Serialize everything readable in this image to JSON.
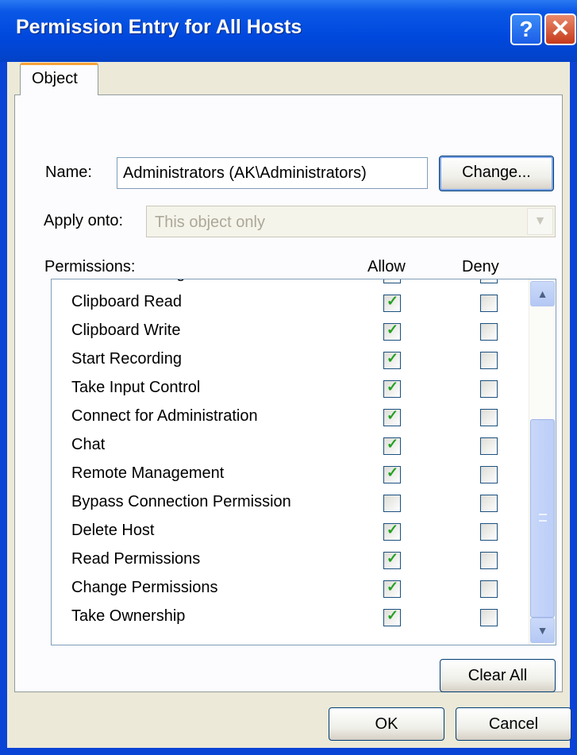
{
  "window": {
    "title": "Permission Entry for All Hosts",
    "help_glyph": "?",
    "close_glyph": "✕"
  },
  "tabs": [
    {
      "label": "Object"
    }
  ],
  "name_field": {
    "label": "Name:",
    "value": "Administrators (AK\\Administrators)"
  },
  "change_button": "Change...",
  "apply_onto": {
    "label": "Apply onto:",
    "value": "This object only"
  },
  "permissions": {
    "header_label": "Permissions:",
    "allow_label": "Allow",
    "deny_label": "Deny",
    "rows": [
      {
        "name": "Remote Printing",
        "allow": true,
        "deny": false
      },
      {
        "name": "Clipboard Read",
        "allow": true,
        "deny": false
      },
      {
        "name": "Clipboard Write",
        "allow": true,
        "deny": false
      },
      {
        "name": "Start Recording",
        "allow": true,
        "deny": false
      },
      {
        "name": "Take Input Control",
        "allow": true,
        "deny": false
      },
      {
        "name": "Connect for Administration",
        "allow": true,
        "deny": false
      },
      {
        "name": "Chat",
        "allow": true,
        "deny": false
      },
      {
        "name": "Remote Management",
        "allow": true,
        "deny": false
      },
      {
        "name": "Bypass Connection Permission",
        "allow": false,
        "deny": false
      },
      {
        "name": "Delete Host",
        "allow": true,
        "deny": false
      },
      {
        "name": "Read Permissions",
        "allow": true,
        "deny": false
      },
      {
        "name": "Change Permissions",
        "allow": true,
        "deny": false
      },
      {
        "name": "Take Ownership",
        "allow": true,
        "deny": false
      }
    ]
  },
  "clear_all_button": "Clear All",
  "ok_button": "OK",
  "cancel_button": "Cancel",
  "colors": {
    "titlebar": "#0048dd",
    "dialog_bg": "#ece9d8",
    "tab_accent": "#f7a23b",
    "checkmark": "#21a121"
  },
  "icons": {
    "scroll_up": "chevron-up-icon",
    "scroll_down": "chevron-down-icon",
    "dropdown": "chevron-down-icon"
  }
}
